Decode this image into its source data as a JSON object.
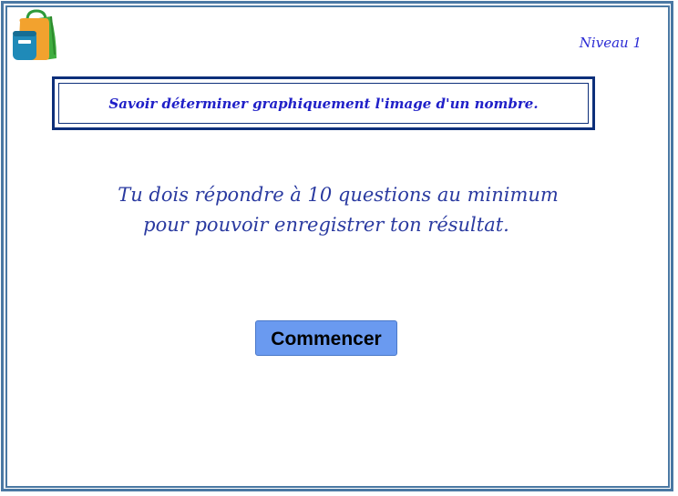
{
  "header": {
    "logo_icon": "backpack-icon",
    "level_label": "Niveau 1"
  },
  "title": {
    "text": "Savoir déterminer graphiquement l'image d'un nombre."
  },
  "instructions": {
    "line1": "Tu dois répondre à 10 questions au minimum",
    "line2": "pour pouvoir enregistrer ton résultat."
  },
  "actions": {
    "start_label": "Commencer"
  },
  "colors": {
    "frame": "#4a78a3",
    "title_border": "#0d2f7a",
    "text_blue": "#2020c8",
    "button_bg": "#6a9af0"
  }
}
